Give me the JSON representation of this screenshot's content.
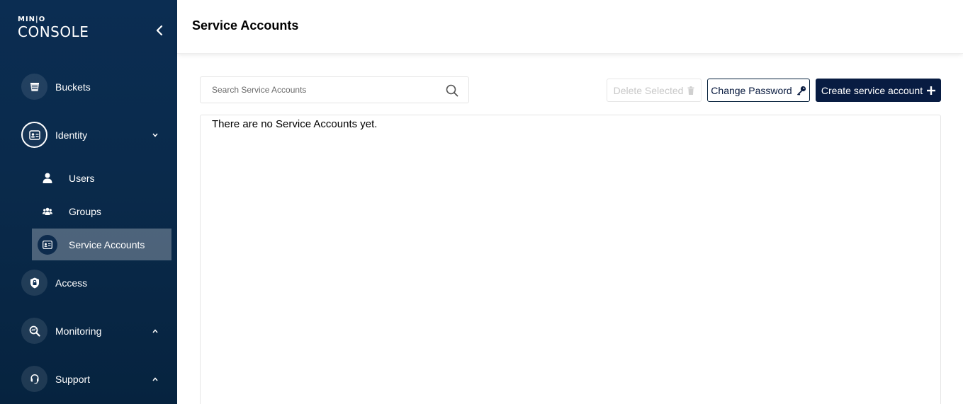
{
  "app": {
    "logo_top": "MIN|O",
    "logo_bottom": "CONSOLE"
  },
  "sidebar": {
    "items": [
      {
        "label": "Buckets",
        "icon": "bucket-icon"
      },
      {
        "label": "Identity",
        "icon": "identity-card-icon",
        "expanded": true
      },
      {
        "label": "Access",
        "icon": "shield-lock-icon"
      },
      {
        "label": "Monitoring",
        "icon": "magnifier-chart-icon"
      },
      {
        "label": "Support",
        "icon": "headset-icon"
      }
    ],
    "identity_children": [
      {
        "label": "Users",
        "icon": "user-icon"
      },
      {
        "label": "Groups",
        "icon": "users-group-icon"
      },
      {
        "label": "Service Accounts",
        "icon": "service-account-icon",
        "selected": true
      }
    ]
  },
  "header": {
    "title": "Service Accounts"
  },
  "toolbar": {
    "search_placeholder": "Search Service Accounts",
    "delete_label": "Delete Selected",
    "change_password_label": "Change Password",
    "create_label": "Create service account"
  },
  "main": {
    "empty_message": "There are no Service Accounts yet."
  },
  "colors": {
    "sidebar_bg": "#0b2d52",
    "primary_button": "#081c42",
    "selected_item": "rgba(255,255,255,0.28)"
  }
}
